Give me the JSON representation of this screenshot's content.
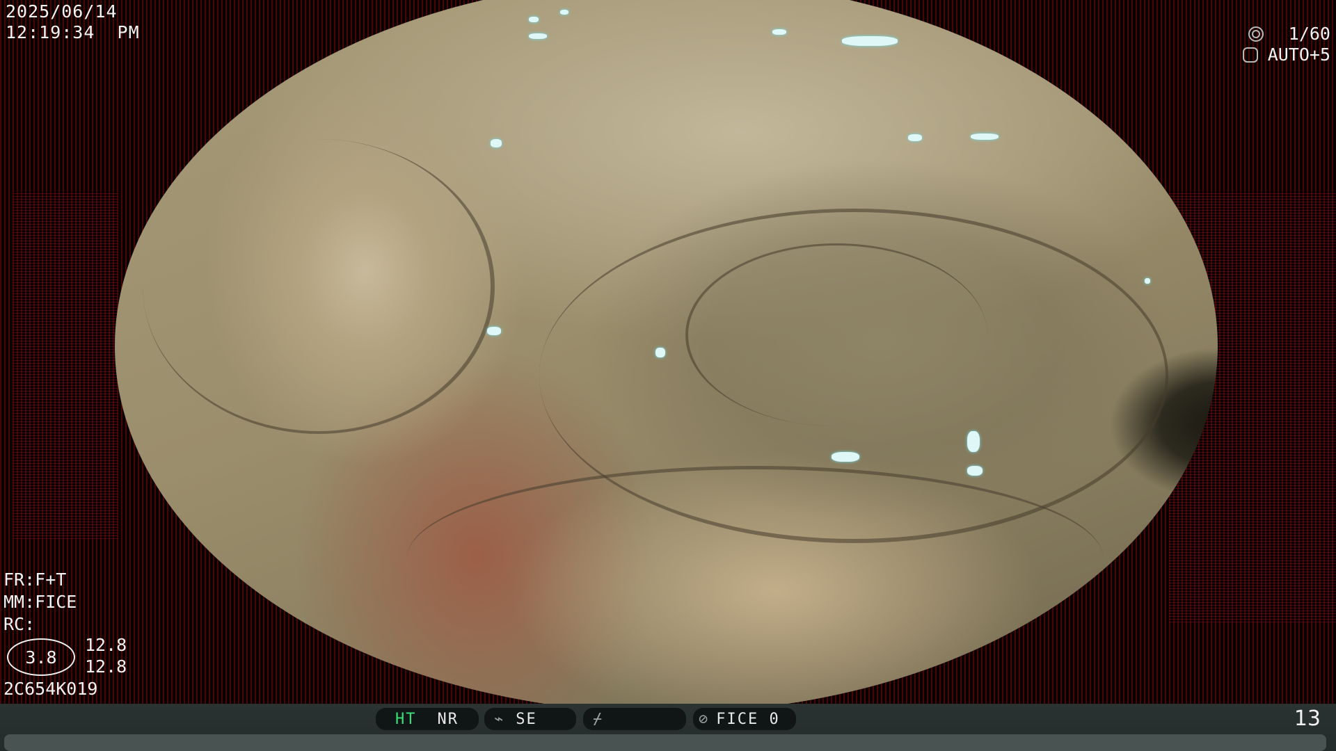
{
  "header": {
    "date": "2025/06/14",
    "time": "12:19:34  PM"
  },
  "exposure": {
    "shutter": "1/60",
    "mode": "AUTO+5"
  },
  "settings": {
    "fr": "FR:F+T",
    "mm": "MM:FICE",
    "rc": "RC:"
  },
  "color_enhance": {
    "value": "3.8",
    "line1": "12.8",
    "line2": "12.8"
  },
  "scope_id": "2C654K019",
  "status_bar": {
    "ht": "HT",
    "nr": "NR",
    "se": "SE",
    "fice": "FICE 0",
    "page": "13"
  },
  "icons": {
    "shutter": "iris-icon",
    "exposure": "hexagon-icon",
    "se": "wave-icon",
    "empty": "slash-icon",
    "fice": "fice-icon"
  }
}
